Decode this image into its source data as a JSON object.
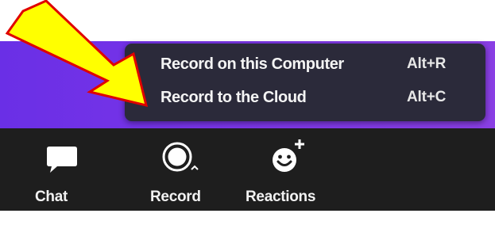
{
  "record_menu": {
    "items": [
      {
        "label": "Record on this Computer",
        "shortcut": "Alt+R"
      },
      {
        "label": "Record to the Cloud",
        "shortcut": "Alt+C"
      }
    ]
  },
  "toolbar": {
    "buttons": [
      {
        "label": "Chat",
        "icon": "chat-bubble-icon"
      },
      {
        "label": "Record",
        "icon": "record-icon"
      },
      {
        "label": "Reactions",
        "icon": "emoji-add-icon"
      }
    ]
  },
  "colors": {
    "meeting_background": "#7a35e8",
    "toolbar_background": "#1e1e1e",
    "menu_background": "#2b2a3a",
    "annotation_arrow_fill": "#ffff00",
    "annotation_arrow_outline": "#e00000"
  }
}
